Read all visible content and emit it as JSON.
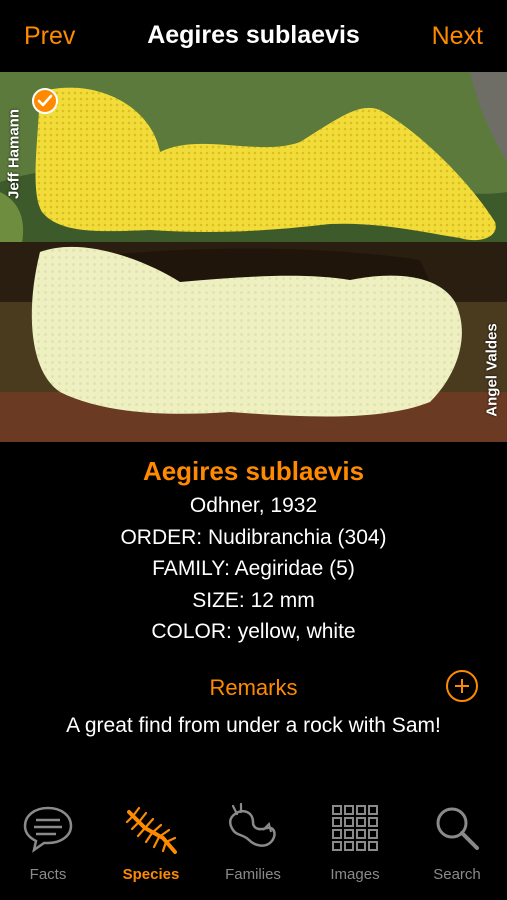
{
  "nav": {
    "prev": "Prev",
    "title": "Aegires sublaevis",
    "next": "Next"
  },
  "photo": {
    "credit_left": "Jeff Hamann",
    "credit_right": "Angel Valdes",
    "selected_icon": "checkmark-icon"
  },
  "species": {
    "scientific_name": "Aegires sublaevis",
    "author": "Odhner, 1932",
    "order": "ORDER: Nudibranchia (304)",
    "family": "FAMILY: Aegiridae (5)",
    "size": "SIZE: 12 mm",
    "color": "COLOR: yellow, white"
  },
  "remarks": {
    "label": "Remarks",
    "add_icon": "plus-circle-icon",
    "text": "A great find from under a rock with Sam!"
  },
  "tabs": [
    {
      "label": "Facts",
      "icon": "speech-bubble-icon",
      "active": false
    },
    {
      "label": "Species",
      "icon": "nudibranch-icon",
      "active": true
    },
    {
      "label": "Families",
      "icon": "sea-slug-outline-icon",
      "active": false
    },
    {
      "label": "Images",
      "icon": "grid-icon",
      "active": false
    },
    {
      "label": "Search",
      "icon": "search-icon",
      "active": false
    }
  ],
  "colors": {
    "accent": "#ff8a00",
    "background": "#000000",
    "inactive": "#8a8a8a"
  }
}
